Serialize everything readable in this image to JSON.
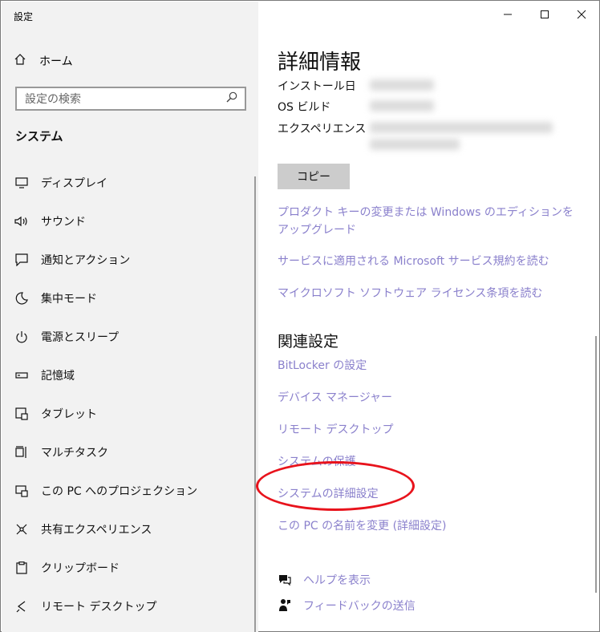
{
  "window": {
    "title": "設定",
    "controls": [
      "minimize-icon",
      "maximize-icon",
      "close-icon"
    ]
  },
  "sidebar": {
    "home_label": "ホーム",
    "search_placeholder": "設定の検索",
    "section_title": "システム",
    "items": [
      {
        "label": "ディスプレイ",
        "icon": "display-icon"
      },
      {
        "label": "サウンド",
        "icon": "sound-icon"
      },
      {
        "label": "通知とアクション",
        "icon": "notification-icon"
      },
      {
        "label": "集中モード",
        "icon": "moon-icon"
      },
      {
        "label": "電源とスリープ",
        "icon": "power-icon"
      },
      {
        "label": "記憶域",
        "icon": "storage-icon"
      },
      {
        "label": "タブレット",
        "icon": "tablet-icon"
      },
      {
        "label": "マルチタスク",
        "icon": "multitask-icon"
      },
      {
        "label": "この PC へのプロジェクション",
        "icon": "projection-icon"
      },
      {
        "label": "共有エクスペリエンス",
        "icon": "share-icon"
      },
      {
        "label": "クリップボード",
        "icon": "clipboard-icon"
      },
      {
        "label": "リモート デスクトップ",
        "icon": "remote-icon"
      }
    ]
  },
  "main": {
    "title": "詳細情報",
    "info": [
      {
        "label": "インストール日"
      },
      {
        "label": "OS ビルド"
      },
      {
        "label": "エクスペリエンス"
      }
    ],
    "copy_label": "コピー",
    "links": [
      "プロダクト キーの変更または Windows のエディションをアップグレード",
      "サービスに適用される Microsoft サービス規約を読む",
      "マイクロソフト ソフトウェア ライセンス条項を読む"
    ],
    "related_title": "関連設定",
    "related_links": [
      "BitLocker の設定",
      "デバイス マネージャー",
      "リモート デスクトップ",
      "システムの保護",
      "システムの詳細設定",
      "この PC の名前を変更 (詳細設定)"
    ],
    "help_label": "ヘルプを表示",
    "feedback_label": "フィードバックの送信"
  },
  "colors": {
    "link": "#8a80cc",
    "sidebar_bg": "#f2f2f2",
    "annotation": "#e8131c"
  }
}
